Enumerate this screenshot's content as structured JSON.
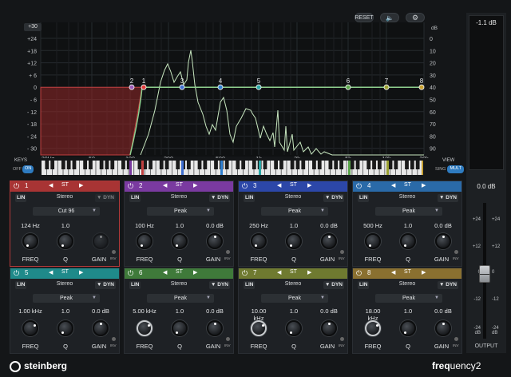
{
  "header": {
    "reset_label": "RESET",
    "speaker_icon": "speaker-icon",
    "settings_icon": "gear-icon"
  },
  "graph": {
    "db_unit_left": "dB",
    "db_unit_right": "dB",
    "range_select": "+30",
    "left_scale": [
      "+24",
      "+18",
      "+12",
      "+ 6",
      "0",
      "- 6",
      "- 12",
      "- 18",
      "- 24",
      "- 30"
    ],
    "right_scale": [
      "0",
      "10",
      "20",
      "30",
      "40",
      "50",
      "60",
      "70",
      "80",
      "90"
    ],
    "freq_labels": [
      "20Hz",
      "50",
      "100",
      "200",
      "500",
      "1k",
      "2k",
      "5k",
      "10k",
      "20k"
    ],
    "band_markers": [
      "2",
      "1",
      "3",
      "4",
      "5",
      "6",
      "7",
      "8"
    ],
    "marker_colors": [
      "#9b59b6",
      "#e03a3a",
      "#3f6fd0",
      "#2f7fd0",
      "#2aa6a6",
      "#5aa54a",
      "#9aa030",
      "#c8a030"
    ]
  },
  "keys": {
    "title": "KEYS",
    "off": "OFF",
    "on": "ON"
  },
  "view": {
    "title": "VIEW",
    "sing": "SING",
    "mult": "MULT"
  },
  "output": {
    "meter_value": "-1.1 dB",
    "gain_value": "0.0 dB",
    "label": "OUTPUT",
    "scale": [
      "+24",
      "+12",
      "0",
      "-12",
      "-24 dB"
    ]
  },
  "bands": [
    {
      "num": "1",
      "mode": "ST",
      "lin": "LIN",
      "stereo": "Stereo",
      "dyn": "DYN",
      "type": "Cut 96",
      "freq": "124 Hz",
      "q": "1.0",
      "gain": "",
      "color": "#a83434",
      "sel": true
    },
    {
      "num": "2",
      "mode": "ST",
      "lin": "LIN",
      "stereo": "Stereo",
      "dyn": "DYN",
      "type": "Peak",
      "freq": "100 Hz",
      "q": "1.0",
      "gain": "0.0 dB",
      "color": "#7a3aa0"
    },
    {
      "num": "3",
      "mode": "ST",
      "lin": "LIN",
      "stereo": "Stereo",
      "dyn": "DYN",
      "type": "Peak",
      "freq": "250 Hz",
      "q": "1.0",
      "gain": "0.0 dB",
      "color": "#2c47a8"
    },
    {
      "num": "4",
      "mode": "ST",
      "lin": "LIN",
      "stereo": "Stereo",
      "dyn": "DYN",
      "type": "Peak",
      "freq": "500 Hz",
      "q": "1.0",
      "gain": "0.0 dB",
      "color": "#2a6aa8"
    },
    {
      "num": "5",
      "mode": "ST",
      "lin": "LIN",
      "stereo": "Stereo",
      "dyn": "DYN",
      "type": "Peak",
      "freq": "1.00 kHz",
      "q": "1.0",
      "gain": "0.0 dB",
      "color": "#1f8a8a"
    },
    {
      "num": "6",
      "mode": "ST",
      "lin": "LIN",
      "stereo": "Stereo",
      "dyn": "DYN",
      "type": "Peak",
      "freq": "5.00 kHz",
      "q": "1.0",
      "gain": "0.0 dB",
      "color": "#3f7a3a"
    },
    {
      "num": "7",
      "mode": "ST",
      "lin": "LIN",
      "stereo": "Stereo",
      "dyn": "DYN",
      "type": "Peak",
      "freq": "10.00 kHz",
      "q": "1.0",
      "gain": "0.0 dB",
      "color": "#6f7a30"
    },
    {
      "num": "8",
      "mode": "ST",
      "lin": "LIN",
      "stereo": "Stereo",
      "dyn": "DYN",
      "type": "Peak",
      "freq": "18.00 kHz",
      "q": "1.0",
      "gain": "0.0 dB",
      "color": "#8a7030"
    }
  ],
  "knob_labels": {
    "freq": "FREQ",
    "q": "Q",
    "gain": "GAIN",
    "inv": "INV"
  },
  "footer": {
    "brand": "steinberg",
    "product_a": "freq",
    "product_b": "uency2"
  }
}
